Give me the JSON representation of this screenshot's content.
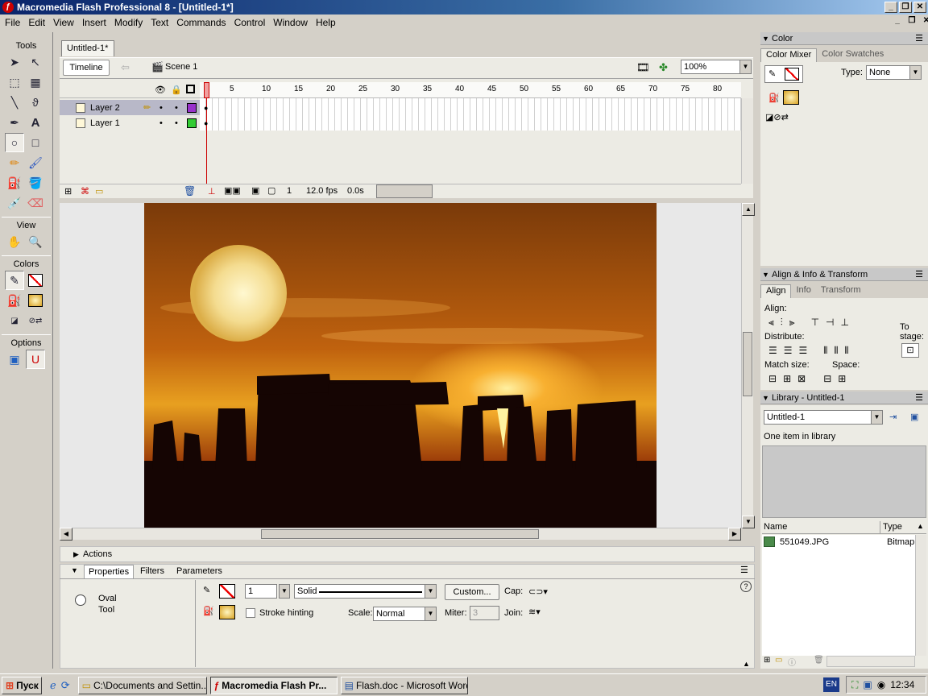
{
  "window": {
    "title": "Macromedia Flash Professional 8 - [Untitled-1*]"
  },
  "menu": [
    "File",
    "Edit",
    "View",
    "Insert",
    "Modify",
    "Text",
    "Commands",
    "Control",
    "Window",
    "Help"
  ],
  "tools": {
    "title": "Tools",
    "view_label": "View",
    "colors_label": "Colors",
    "options_label": "Options"
  },
  "document": {
    "tab": "Untitled-1*",
    "timeline_button": "Timeline",
    "scene": "Scene 1",
    "zoom": "100%"
  },
  "timeline": {
    "layers": [
      {
        "name": "Layer 2",
        "color": "#9933cc"
      },
      {
        "name": "Layer 1",
        "color": "#33cc33"
      }
    ],
    "ruler": [
      "1",
      "5",
      "10",
      "15",
      "20",
      "25",
      "30",
      "35",
      "40",
      "45",
      "50",
      "55",
      "60",
      "65",
      "70",
      "75",
      "80"
    ],
    "current_frame": "1",
    "fps": "12.0 fps",
    "elapsed": "0.0s"
  },
  "actions_panel": {
    "title": "Actions"
  },
  "properties": {
    "tabs": [
      "Properties",
      "Filters",
      "Parameters"
    ],
    "tool_name_1": "Oval",
    "tool_name_2": "Tool",
    "stroke_width": "1",
    "stroke_style": "Solid",
    "custom_button": "Custom...",
    "cap_label": "Cap:",
    "stroke_hinting": "Stroke hinting",
    "scale_label": "Scale:",
    "scale_value": "Normal",
    "miter_label": "Miter:",
    "miter_value": "3",
    "join_label": "Join:"
  },
  "color_panel": {
    "title": "Color",
    "tabs": [
      "Color Mixer",
      "Color Swatches"
    ],
    "type_label": "Type:",
    "type_value": "None"
  },
  "align_panel": {
    "title": "Align & Info & Transform",
    "tabs": [
      "Align",
      "Info",
      "Transform"
    ],
    "align_label": "Align:",
    "distribute_label": "Distribute:",
    "match_label": "Match size:",
    "space_label": "Space:",
    "to_stage_1": "To",
    "to_stage_2": "stage:"
  },
  "library_panel": {
    "title": "Library - Untitled-1",
    "doc_select": "Untitled-1",
    "count_text": "One item in library",
    "col_name": "Name",
    "col_type": "Type",
    "items": [
      {
        "name": "551049.JPG",
        "type": "Bitmap"
      }
    ]
  },
  "taskbar": {
    "start": "Пуск",
    "items": [
      "C:\\Documents and Settin...",
      "Macromedia Flash Pr...",
      "Flash.doc - Microsoft Word"
    ],
    "lang": "EN",
    "clock": "12:34"
  }
}
